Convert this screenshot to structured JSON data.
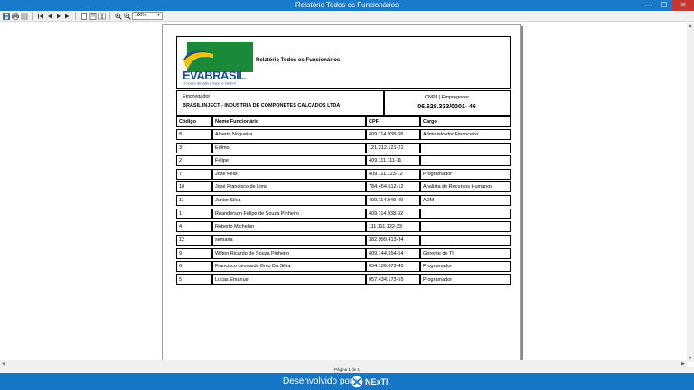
{
  "window": {
    "title": "Relatório Todos os Funcionários",
    "minimize": "—",
    "maximize": "☐",
    "close": "✕"
  },
  "toolbar": {
    "zoom": "100%"
  },
  "report": {
    "title": "Relatório Todos os Funcionários",
    "logo": {
      "brand": "EVABRASIL",
      "slogan": "O nosso desafio é fazer o melhor",
      "colors": {
        "green": "#1a8a3a",
        "yellow": "#f4c20d",
        "blue": "#1b4f9c"
      }
    },
    "employer_label": "Empregador",
    "employer_name": "BRASIL INJECT - INDUSTRIA DE COMPONETES CALÇADOS LTDA",
    "cnpj_label": "CNPJ | Empregador",
    "cnpj_value": "06.628.333/0001- 46",
    "columns": [
      "Código",
      "Nome Funcionário",
      "CPF",
      "Cargo"
    ],
    "rows": [
      [
        "8",
        "Alberto Nogueira",
        "409.114.938-38",
        "Administrador Financeiro"
      ],
      [
        "3",
        "Edimo",
        "121.212.121-21",
        ""
      ],
      [
        "2",
        "Felipe",
        "409.111.111-11",
        ""
      ],
      [
        "7",
        "José Felix",
        "409.111.123-12",
        "Programador"
      ],
      [
        "10",
        "José Francisco de Lima",
        "784.454.512-12",
        "Analista de Recursos Humanos"
      ],
      [
        "11",
        "Junior Silva",
        "409.114.949-49",
        "ADM"
      ],
      [
        "1",
        "Roanderson Felipe de Souza Pinheiro",
        "409.114.938-32",
        ""
      ],
      [
        "4",
        "Roberto Michelan",
        "111.111.122-33",
        ""
      ],
      [
        "12",
        "semaria",
        "382.999.413-34",
        ""
      ],
      [
        "9",
        "Wilton Ricardo de Souza Pinheiro",
        "409.144.554-54",
        "Gerente de TI"
      ],
      [
        "6",
        "Francisco Leonardo Brito Da Silva",
        "054.136.673-45",
        "Programador"
      ],
      [
        "5",
        "Lucas Emanuel",
        "057.434.173-55",
        "Programador"
      ]
    ]
  },
  "status": {
    "page_info": "Página 1 de 1"
  },
  "footer": {
    "developed_by": "Desenvolvido por",
    "brand": "NExTI"
  },
  "colors": {
    "titlebar": "#1979ca",
    "footer": "#1677c8",
    "close": "#c7372f"
  }
}
